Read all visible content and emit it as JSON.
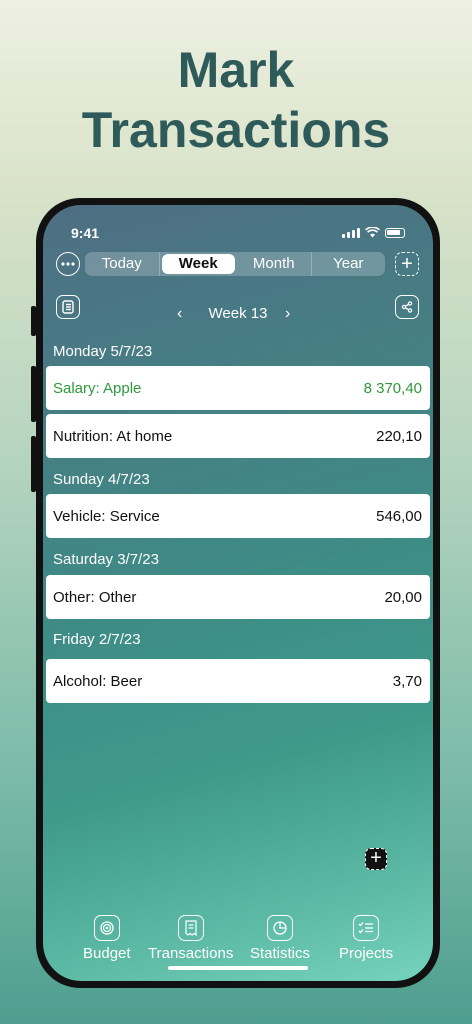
{
  "headline": {
    "line1": "Mark",
    "line2": "Transactions"
  },
  "status_bar": {
    "time": "9:41"
  },
  "toolbar": {
    "more_icon": "ellipsis-circle-icon",
    "segments": [
      "Today",
      "Week",
      "Month",
      "Year"
    ],
    "selected_segment": "Week",
    "add_icon": "plus-square-icon"
  },
  "week_nav": {
    "label": "Week 13",
    "prev_icon": "chevron-left-icon",
    "next_icon": "chevron-right-icon",
    "list_icon": "list-icon",
    "share_icon": "share-icon"
  },
  "days": [
    {
      "header": "Monday 5/7/23",
      "transactions": [
        {
          "name": "Salary: Apple",
          "amount": "8 370,40",
          "type": "income"
        },
        {
          "name": "Nutrition: At home",
          "amount": "220,10",
          "type": "expense"
        }
      ]
    },
    {
      "header": "Sunday 4/7/23",
      "transactions": [
        {
          "name": "Vehicle: Service",
          "amount": "546,00",
          "type": "expense"
        }
      ]
    },
    {
      "header": "Saturday 3/7/23",
      "transactions": [
        {
          "name": "Other: Other",
          "amount": "20,00",
          "type": "expense"
        }
      ]
    },
    {
      "header": "Friday 2/7/23",
      "transactions": [
        {
          "name": "Alcohol: Beer",
          "amount": "3,70",
          "type": "expense"
        }
      ]
    }
  ],
  "fab": {
    "icon": "plus-icon"
  },
  "tab_bar": [
    {
      "label": "Budget",
      "icon": "budget-icon"
    },
    {
      "label": "Transactions",
      "icon": "receipt-icon"
    },
    {
      "label": "Statistics",
      "icon": "pie-chart-icon"
    },
    {
      "label": "Projects",
      "icon": "checklist-icon"
    }
  ],
  "colors": {
    "income": "#2f9a3a",
    "headline": "#2f5a5a"
  }
}
